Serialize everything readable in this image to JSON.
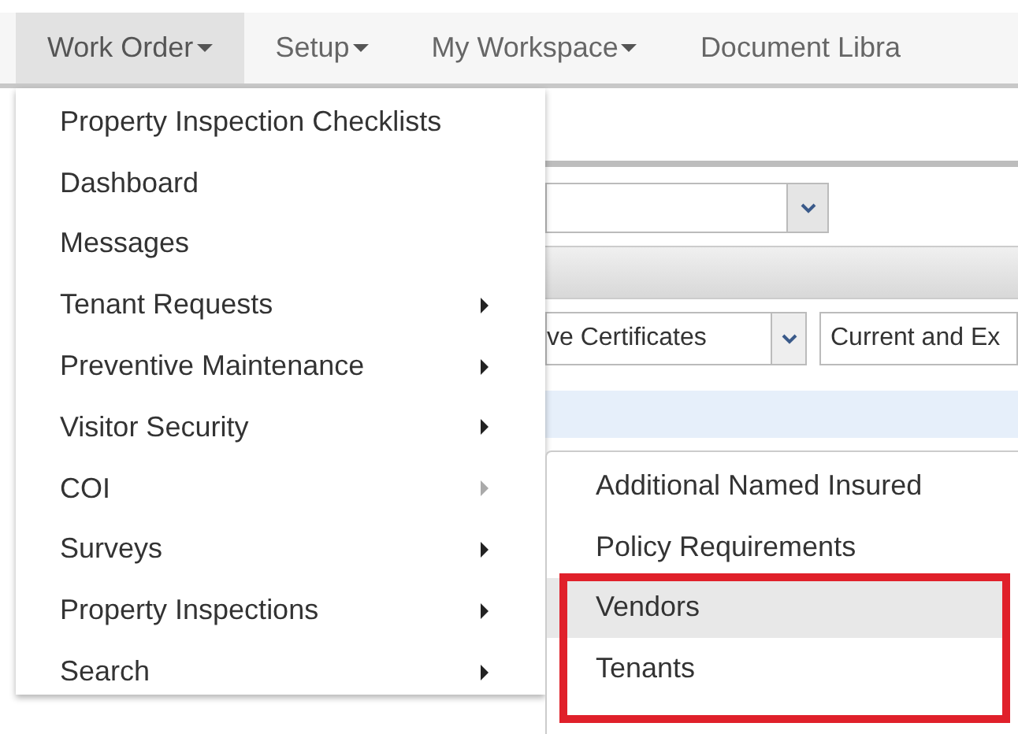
{
  "nav": [
    {
      "label": "Work Order",
      "selected": true,
      "caret": true
    },
    {
      "label": "Setup",
      "selected": false,
      "caret": true
    },
    {
      "label": "My Workspace",
      "selected": false,
      "caret": true
    },
    {
      "label": "Document Libra",
      "selected": false,
      "caret": false
    }
  ],
  "menu": [
    {
      "label": "Property Inspection Checklists",
      "submenu": false
    },
    {
      "label": "Dashboard",
      "submenu": false
    },
    {
      "label": "Messages",
      "submenu": false
    },
    {
      "label": "Tenant Requests",
      "submenu": true,
      "expanded": false
    },
    {
      "label": "Preventive Maintenance",
      "submenu": true,
      "expanded": false
    },
    {
      "label": "Visitor Security",
      "submenu": true,
      "expanded": false
    },
    {
      "label": "COI",
      "submenu": true,
      "expanded": true
    },
    {
      "label": "Surveys",
      "submenu": true,
      "expanded": false
    },
    {
      "label": "Property Inspections",
      "submenu": true,
      "expanded": false
    },
    {
      "label": "Search",
      "submenu": true,
      "expanded": false
    }
  ],
  "submenu": [
    {
      "label": "Additional Named Insured",
      "selected": false
    },
    {
      "label": "Policy Requirements",
      "selected": false
    },
    {
      "label": "Vendors",
      "selected": true
    },
    {
      "label": "Tenants",
      "selected": false
    }
  ],
  "page": {
    "certificate_filter": "ve Certificates",
    "status_filter": "Current and Ex"
  }
}
